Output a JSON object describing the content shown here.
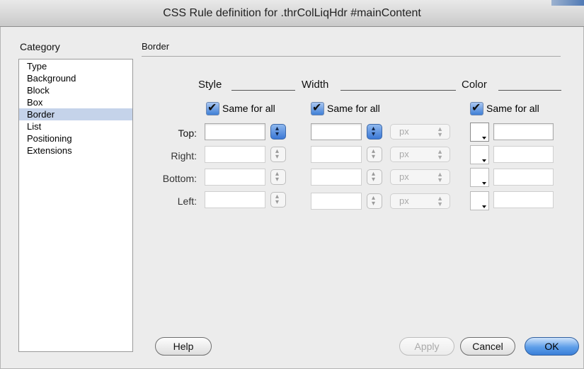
{
  "window": {
    "title": "CSS Rule definition for .thrColLiqHdr #mainContent"
  },
  "sidebar": {
    "label": "Category",
    "items": [
      {
        "label": "Type"
      },
      {
        "label": "Background"
      },
      {
        "label": "Block"
      },
      {
        "label": "Box"
      },
      {
        "label": "Border",
        "selected": true
      },
      {
        "label": "List"
      },
      {
        "label": "Positioning"
      },
      {
        "label": "Extensions"
      }
    ]
  },
  "panel": {
    "title": "Border",
    "columns": {
      "style": "Style",
      "width": "Width",
      "color": "Color"
    },
    "same_for_all": {
      "style": {
        "label": "Same for all",
        "checked": true
      },
      "width": {
        "label": "Same for all",
        "checked": true
      },
      "color": {
        "label": "Same for all",
        "checked": true
      }
    },
    "rows": [
      {
        "label": "Top:",
        "style": "",
        "width": "",
        "unit": "px",
        "color": ""
      },
      {
        "label": "Right:",
        "style": "",
        "width": "",
        "unit": "px",
        "color": ""
      },
      {
        "label": "Bottom:",
        "style": "",
        "width": "",
        "unit": "px",
        "color": ""
      },
      {
        "label": "Left:",
        "style": "",
        "width": "",
        "unit": "px",
        "color": ""
      }
    ]
  },
  "buttons": {
    "help": "Help",
    "apply": "Apply",
    "cancel": "Cancel",
    "ok": "OK"
  },
  "colors": {
    "selection": "#c5d3ea",
    "accent": "#3b7fd8"
  }
}
